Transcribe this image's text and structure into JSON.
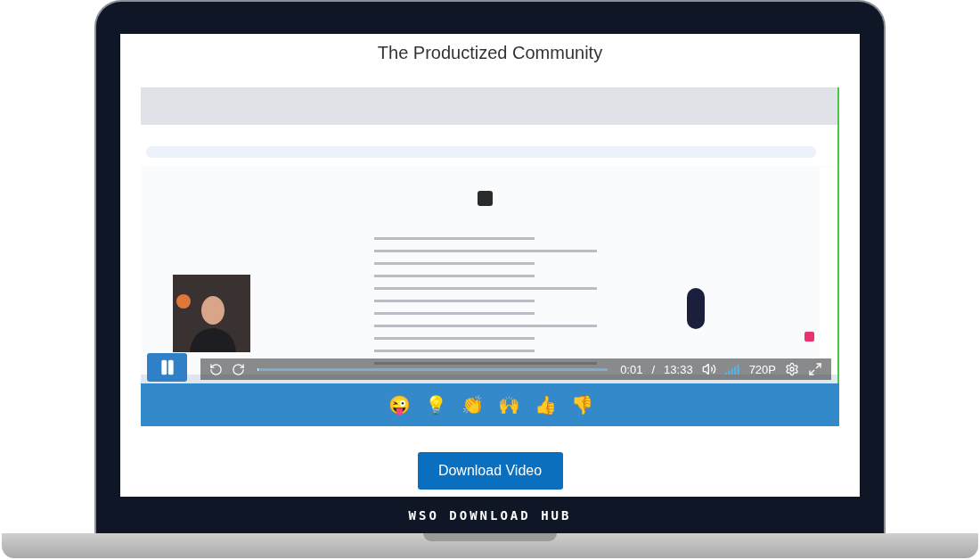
{
  "page_title": "The Productized Community",
  "video": {
    "player": {
      "playing": true,
      "progress": {
        "level": 0.002
      },
      "current": "0:01",
      "separator": "/",
      "duration": "13:33",
      "quality": "720P"
    },
    "reactions": [
      "😜",
      "💡",
      "👏",
      "🙌",
      "👍",
      "👎"
    ]
  },
  "download_button": "Download Video",
  "laptop_label": "WSO DOWNLOAD HUB"
}
